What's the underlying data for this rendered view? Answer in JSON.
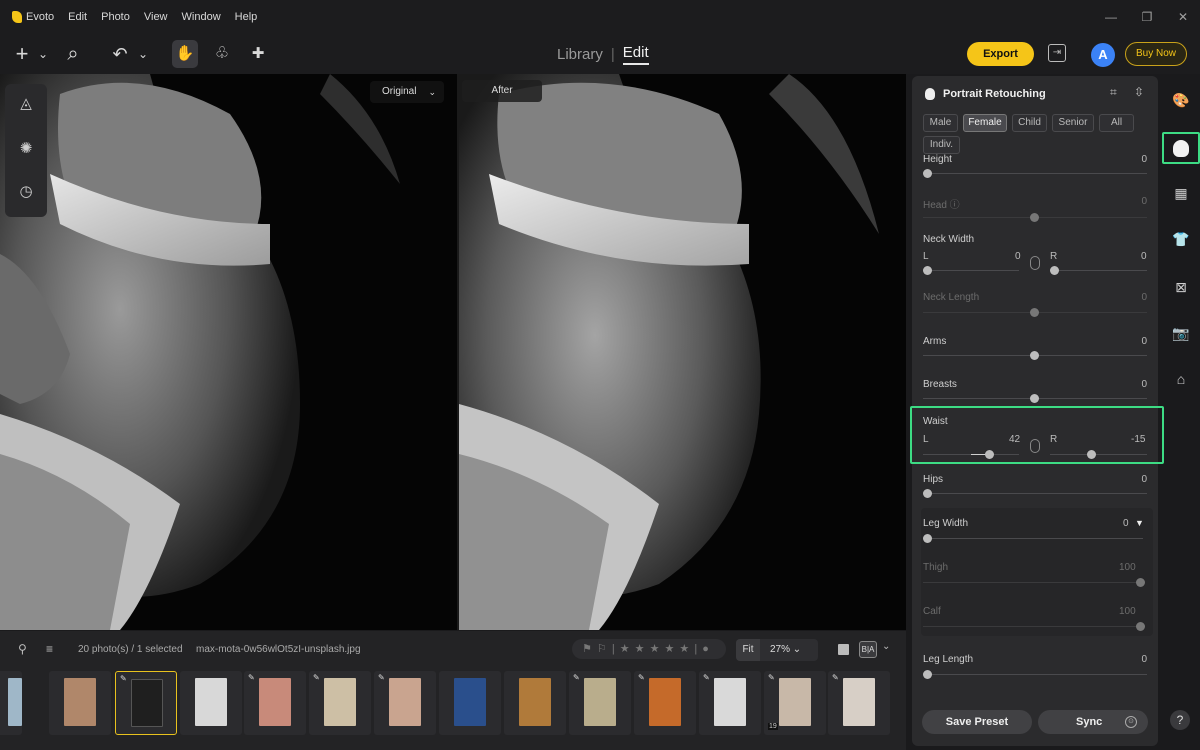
{
  "menubar": {
    "app_name": "Evoto",
    "items": [
      "Edit",
      "Photo",
      "View",
      "Window",
      "Help"
    ],
    "window_controls": [
      "—",
      "❐",
      "✕"
    ]
  },
  "toolbar": {
    "add_icon": "+",
    "add_chevron": "⌄",
    "search_icon": "⌕",
    "undo_icon": "↶",
    "undo_chevron": "⌄",
    "hand_icon": "✋",
    "brush_icon": "♧",
    "bandage_icon": "✚",
    "mode_library": "Library",
    "mode_sep": "|",
    "mode_edit": "Edit",
    "export_label": "Export",
    "share_icon": "⇥",
    "avatar_letter": "A",
    "buy_label": "Buy Now"
  },
  "canvas": {
    "original_label": "Original",
    "original_chevron": "⌄",
    "after_label": "After",
    "tools": [
      "◬",
      "✺",
      "◷"
    ],
    "info_icon": "i",
    "compare_icon": "▯"
  },
  "filmstrip": {
    "filter_icon": "⚲",
    "sort_icon": "≡",
    "count": "20 photo(s) / 1 selected",
    "filename": "max-mota-0w56wlOt5zI-unsplash.jpg",
    "rating": "⚑ ⚐ | ★ ★ ★ ★ ★ | ●",
    "fit": "Fit",
    "zoom": "27% ⌄",
    "ba": "B|A",
    "view_chevron": "⌄",
    "thumb_badge_num": "19",
    "thumb_edit_icon": "✎",
    "thumb_colors": [
      "#9fb7c8",
      "#b0876a",
      "#1f1f1f",
      "#d8d8d8",
      "#c88a7a",
      "#cdbfa5",
      "#c9a48f",
      "#2a4f8c",
      "#b07a3a",
      "#b9ad8c",
      "#c56a2a",
      "#d9d9d9",
      "#c8b8a8",
      "#d7cfc6"
    ]
  },
  "panel": {
    "title": "Portrait Retouching",
    "header_icon_1": "⌗",
    "header_icon_2": "⇳",
    "tabs": [
      "Male",
      "Female",
      "Child",
      "Senior",
      "All",
      "Indiv."
    ],
    "active_tab": "Female",
    "height_label": "Height",
    "height_value": "0",
    "head_label": "Head ⓘ",
    "head_value": "0",
    "neck_width_label": "Neck Width",
    "neck_l": "L",
    "neck_l_value": "0",
    "neck_r": "R",
    "neck_r_value": "0",
    "neck_length_label": "Neck Length",
    "neck_length_value": "0",
    "arms_label": "Arms",
    "arms_value": "0",
    "breasts_label": "Breasts",
    "breasts_value": "0",
    "waist_label": "Waist",
    "waist_l": "L",
    "waist_l_value": "42",
    "waist_r": "R",
    "waist_r_value": "-15",
    "hips_label": "Hips",
    "hips_value": "0",
    "leg_width_label": "Leg Width",
    "leg_width_value": "0",
    "thigh_label": "Thigh",
    "thigh_value": "100",
    "calf_label": "Calf",
    "calf_value": "100",
    "leg_length_label": "Leg Length",
    "leg_length_value": "0",
    "save_preset": "Save Preset",
    "sync": "Sync",
    "sync_more_icon": "⊙"
  },
  "rail": {
    "icons": [
      "🎨",
      "▦",
      "👕",
      "⊠",
      "📷",
      "⌂"
    ],
    "help": "?"
  }
}
